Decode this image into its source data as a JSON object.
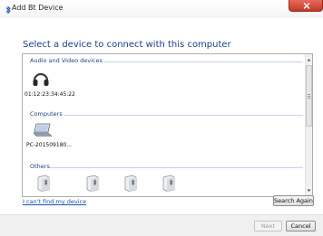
{
  "window": {
    "title": "Add Bt Device",
    "close_icon": "close-icon",
    "bt_icon": "bluetooth-icon"
  },
  "instruction": "Select a device to connect with this computer",
  "groups": [
    {
      "label": "Audio and Video devices",
      "devices": [
        {
          "name": "01:12:23:34:45:22",
          "icon": "headphones-icon"
        }
      ]
    },
    {
      "label": "Computers",
      "devices": [
        {
          "name": "PC-201509180...",
          "icon": "laptop-icon"
        }
      ]
    },
    {
      "label": "Others",
      "devices": [
        {
          "name": "",
          "icon": "generic-device-icon"
        },
        {
          "name": "",
          "icon": "generic-device-icon"
        },
        {
          "name": "",
          "icon": "generic-device-icon"
        },
        {
          "name": "",
          "icon": "generic-device-icon"
        }
      ]
    }
  ],
  "links": {
    "cant_find": "I can't find my device"
  },
  "buttons": {
    "search_again": "Search Again",
    "next": "Next",
    "cancel": "Cancel"
  },
  "colors": {
    "accent": "#1e3e8c",
    "link": "#1a52b8",
    "close": "#c8412f"
  }
}
